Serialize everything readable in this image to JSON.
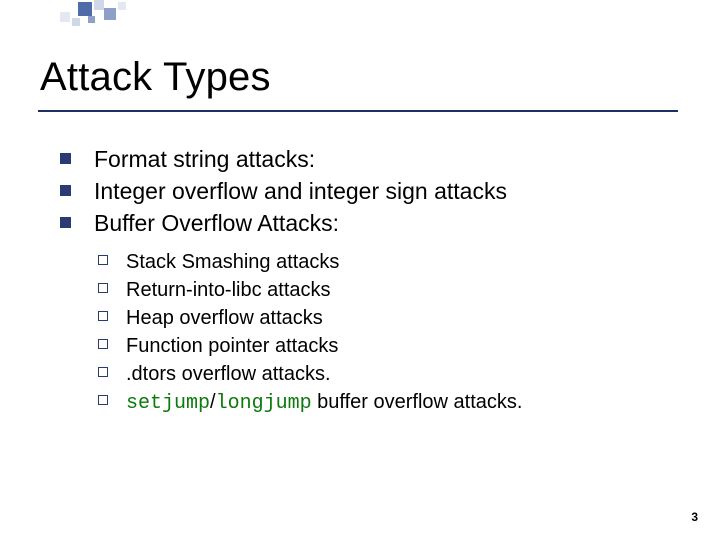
{
  "title": "Attack Types",
  "bullets": [
    "Format string attacks:",
    "Integer overflow and integer sign attacks",
    "Buffer Overflow Attacks:"
  ],
  "sub": [
    "Stack Smashing attacks",
    "Return-into-libc attacks",
    "Heap overflow attacks",
    "Function pointer attacks",
    ".dtors overflow attacks."
  ],
  "sub_last": {
    "code1": "setjump",
    "sep": "/",
    "code2": "longjump",
    "tail": " buffer overflow attacks."
  },
  "page_number": "3"
}
